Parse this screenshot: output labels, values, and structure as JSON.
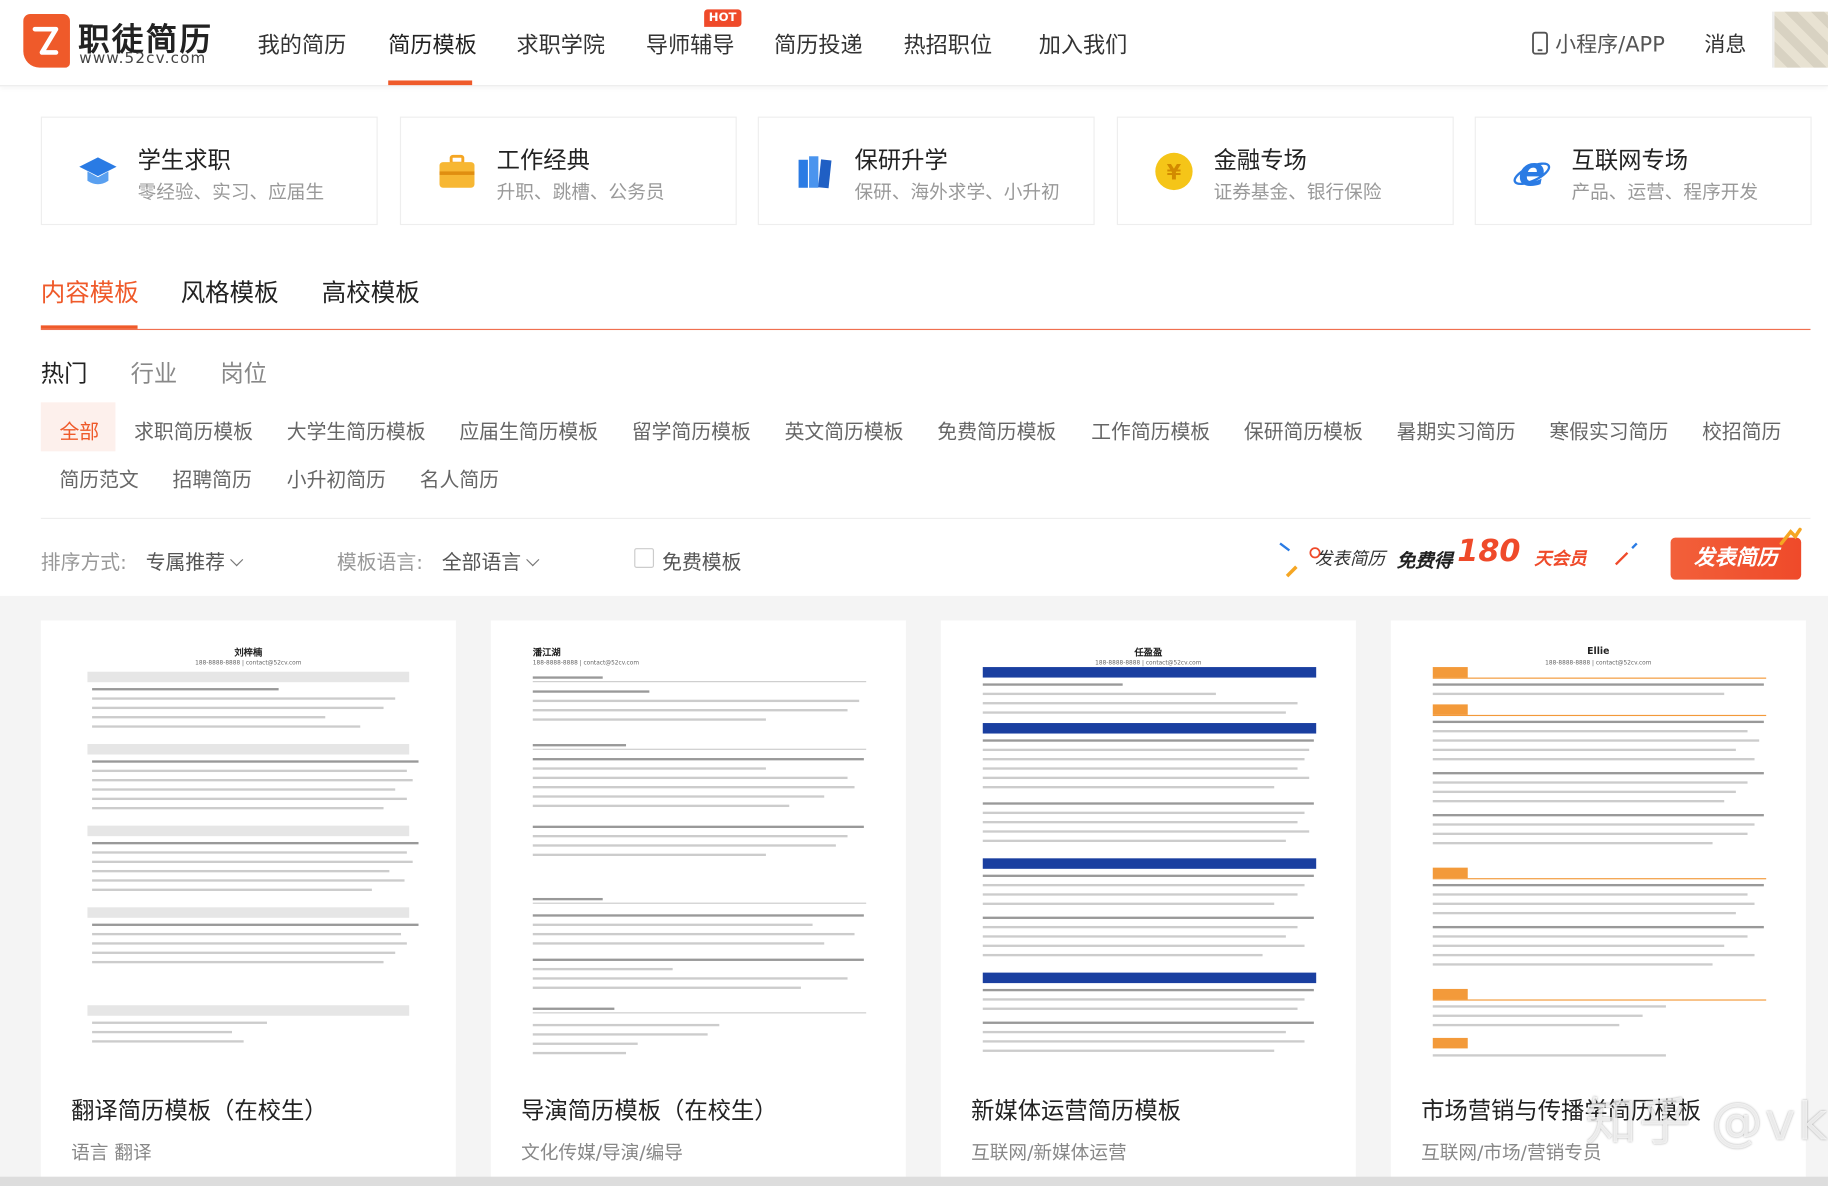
{
  "header": {
    "logo_name": "职徒简历",
    "logo_url": "www.52cv.com",
    "nav": [
      {
        "label": "我的简历"
      },
      {
        "label": "简历模板"
      },
      {
        "label": "求职学院"
      },
      {
        "label": "导师辅导"
      },
      {
        "label": "简历投递"
      },
      {
        "label": "热招职位"
      },
      {
        "label": "加入我们"
      }
    ],
    "hot_badge": "HOT",
    "mini_app": "小程序/APP",
    "messages": "消息"
  },
  "categories": [
    {
      "title": "学生求职",
      "sub": "零经验、实习、应届生",
      "icon": "graduation-cap-icon",
      "color": "#2a7be4"
    },
    {
      "title": "工作经典",
      "sub": "升职、跳槽、公务员",
      "icon": "briefcase-icon",
      "color": "#f5a623"
    },
    {
      "title": "保研升学",
      "sub": "保研、海外求学、小升初",
      "icon": "books-icon",
      "color": "#2a7be4"
    },
    {
      "title": "金融专场",
      "sub": "证券基金、银行保险",
      "icon": "yuan-coin-icon",
      "color": "#f5c518"
    },
    {
      "title": "互联网专场",
      "sub": "产品、运营、程序开发",
      "icon": "browser-e-icon",
      "color": "#2a7be4"
    }
  ],
  "main_tabs": [
    {
      "label": "内容模板"
    },
    {
      "label": "风格模板"
    },
    {
      "label": "高校模板"
    }
  ],
  "sub_tabs": [
    {
      "label": "热门"
    },
    {
      "label": "行业"
    },
    {
      "label": "岗位"
    }
  ],
  "tags_row1": [
    "全部",
    "求职简历模板",
    "大学生简历模板",
    "应届生简历模板",
    "留学简历模板",
    "英文简历模板",
    "免费简历模板",
    "工作简历模板",
    "保研简历模板",
    "暑期实习简历",
    "寒假实习简历",
    "校招简历"
  ],
  "tags_row2": [
    "简历范文",
    "招聘简历",
    "小升初简历",
    "名人简历"
  ],
  "filters": {
    "sort_label": "排序方式:",
    "sort_value": "专属推荐",
    "lang_label": "模板语言:",
    "lang_value": "全部语言",
    "free_label": "免费模板"
  },
  "promo": {
    "text1": "发表简历",
    "text2": "免费得",
    "number": "180",
    "text3": "天会员",
    "button": "发表简历"
  },
  "cards": [
    {
      "title": "翻译简历模板（在校生）",
      "tags": "语言  翻译",
      "name": "刘梓楠",
      "contact": "188-8888-8888  |  contact@52cv.com"
    },
    {
      "title": "导演简历模板（在校生）",
      "tags": "文化传媒/导演/编导",
      "name": "潘江湖",
      "contact": "188-8888-8888  |  contact@52cv.com"
    },
    {
      "title": "新媒体运营简历模板",
      "tags": "互联网/新媒体运营",
      "name": "任盈盈",
      "contact": "188-8888-8888  |  contact@52cv.com"
    },
    {
      "title": "市场营销与传播学简历模板",
      "tags": "互联网/市场/营销专员",
      "name": "Ellie",
      "contact": "188-8888-8888  |  contact@52cv.com"
    }
  ],
  "watermark": "知乎 @vk-ri",
  "colors": {
    "accent": "#ef5a2a",
    "blue_bar": "#1a3fa0",
    "orange_bar": "#f39a3a"
  }
}
